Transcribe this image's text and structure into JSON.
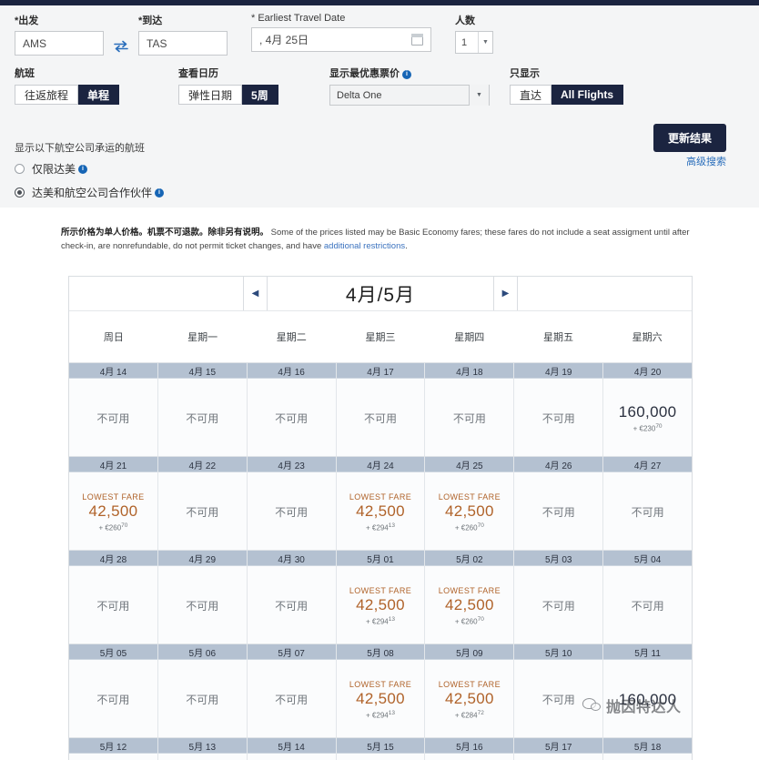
{
  "search": {
    "from": {
      "label": "*出发",
      "value": "AMS"
    },
    "swap_icon": "swap-horizontal-icon",
    "to": {
      "label": "*到达",
      "value": "TAS"
    },
    "date": {
      "label": "* Earliest Travel Date",
      "value": ", 4月 25日",
      "icon": "calendar-icon"
    },
    "passengers": {
      "label": "人数",
      "value": "1"
    },
    "flight_type": {
      "label": "航班",
      "options": [
        "往返旅程",
        "单程"
      ],
      "selected": "单程"
    },
    "view_calendar": {
      "label": "查看日历",
      "options": [
        "弹性日期",
        "5周"
      ],
      "selected": "5周"
    },
    "best_fare": {
      "label": "显示最优惠票价",
      "selected": "Delta One"
    },
    "show_only": {
      "label": "只显示",
      "options": [
        "直达",
        "All Flights"
      ],
      "selected": "All Flights"
    },
    "carriers": {
      "heading": "显示以下航空公司承运的航班",
      "options": [
        {
          "label": "仅限达美",
          "selected": false
        },
        {
          "label": "达美和航空公司合作伙伴",
          "selected": true
        }
      ]
    },
    "update_button": "更新结果",
    "advanced_link": "高级搜索"
  },
  "disclaimer": {
    "cn": "所示价格为单人价格。机票不可退款。除非另有说明。",
    "en": "Some of the prices listed may be Basic Economy fares; these fares do not include a seat assigment until after check-in, are nonrefundable, do not permit ticket changes, and have ",
    "link": "additional restrictions",
    "end": "."
  },
  "calendar": {
    "prev_icon": "chevron-left-icon",
    "next_icon": "chevron-right-icon",
    "month_title": "4月/5月",
    "day_headers": [
      "周日",
      "星期一",
      "星期二",
      "星期三",
      "星期四",
      "星期五",
      "星期六"
    ],
    "unavailable_text": "不可用",
    "lowest_fare_tag": "LOWEST FARE",
    "accent_color": "#b0632a",
    "navy_color": "#2b3140",
    "weeks": [
      {
        "days": [
          {
            "date": "4月 14",
            "available": false,
            "text": "不可用"
          },
          {
            "date": "4月 15",
            "available": false,
            "text": "不可用"
          },
          {
            "date": "4月 16",
            "available": false,
            "text": "不可用"
          },
          {
            "date": "4月 17",
            "available": false,
            "text": "不可用"
          },
          {
            "date": "4月 18",
            "available": false,
            "text": "不可用"
          },
          {
            "date": "4月 19",
            "available": false,
            "text": "不可用"
          },
          {
            "date": "4月 20",
            "available": true,
            "lowest": false,
            "miles": "160,000",
            "tax": "+ €230",
            "tax_cents": "70"
          }
        ]
      },
      {
        "days": [
          {
            "date": "4月 21",
            "available": true,
            "lowest": true,
            "miles": "42,500",
            "tax": "+ €260",
            "tax_cents": "70"
          },
          {
            "date": "4月 22",
            "available": false,
            "text": "不可用"
          },
          {
            "date": "4月 23",
            "available": false,
            "text": "不可用"
          },
          {
            "date": "4月 24",
            "available": true,
            "lowest": true,
            "miles": "42,500",
            "tax": "+ €294",
            "tax_cents": "13"
          },
          {
            "date": "4月 25",
            "available": true,
            "lowest": true,
            "miles": "42,500",
            "tax": "+ €260",
            "tax_cents": "70"
          },
          {
            "date": "4月 26",
            "available": false,
            "text": "不可用"
          },
          {
            "date": "4月 27",
            "available": false,
            "text": "不可用"
          }
        ]
      },
      {
        "days": [
          {
            "date": "4月 28",
            "available": false,
            "text": "不可用"
          },
          {
            "date": "4月 29",
            "available": false,
            "text": "不可用"
          },
          {
            "date": "4月 30",
            "available": false,
            "text": "不可用"
          },
          {
            "date": "5月 01",
            "available": true,
            "lowest": true,
            "miles": "42,500",
            "tax": "+ €294",
            "tax_cents": "13"
          },
          {
            "date": "5月 02",
            "available": true,
            "lowest": true,
            "miles": "42,500",
            "tax": "+ €260",
            "tax_cents": "70"
          },
          {
            "date": "5月 03",
            "available": false,
            "text": "不可用"
          },
          {
            "date": "5月 04",
            "available": false,
            "text": "不可用"
          }
        ]
      },
      {
        "days": [
          {
            "date": "5月 05",
            "available": false,
            "text": "不可用"
          },
          {
            "date": "5月 06",
            "available": false,
            "text": "不可用"
          },
          {
            "date": "5月 07",
            "available": false,
            "text": "不可用"
          },
          {
            "date": "5月 08",
            "available": true,
            "lowest": true,
            "miles": "42,500",
            "tax": "+ €294",
            "tax_cents": "13"
          },
          {
            "date": "5月 09",
            "available": true,
            "lowest": true,
            "miles": "42,500",
            "tax": "+ €284",
            "tax_cents": "72"
          },
          {
            "date": "5月 10",
            "available": false,
            "text": "不可用"
          },
          {
            "date": "5月 11",
            "available": true,
            "lowest": false,
            "miles": "160,000",
            "tax": "",
            "tax_cents": ""
          }
        ]
      },
      {
        "partial": true,
        "days": [
          {
            "date": "5月 12"
          },
          {
            "date": "5月 13"
          },
          {
            "date": "5月 14"
          },
          {
            "date": "5月 15"
          },
          {
            "date": "5月 16"
          },
          {
            "date": "5月 17"
          },
          {
            "date": "5月 18"
          }
        ]
      }
    ]
  },
  "watermark": {
    "text": "抛因特达人",
    "logo": "wechat-logo-icon"
  }
}
